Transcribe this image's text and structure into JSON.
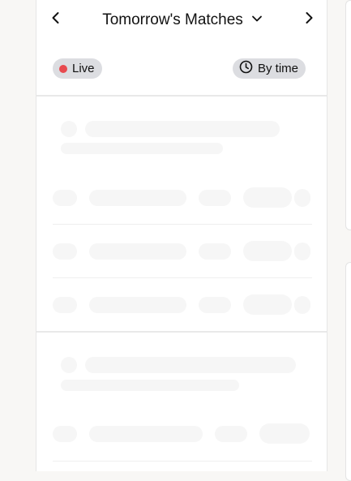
{
  "header": {
    "title": "Tomorrow's Matches",
    "prev_icon": "chevron-left-icon",
    "next_icon": "chevron-right-icon",
    "dropdown_icon": "chevron-down-icon"
  },
  "filters": {
    "live_label": "Live",
    "live_color": "#e84a4f",
    "time_label": "By time",
    "time_icon": "clock-icon"
  },
  "colors": {
    "background": "#f8f7f5",
    "panel": "#ffffff",
    "chip": "#dcdde1",
    "skeleton": "#f6f6f6"
  }
}
